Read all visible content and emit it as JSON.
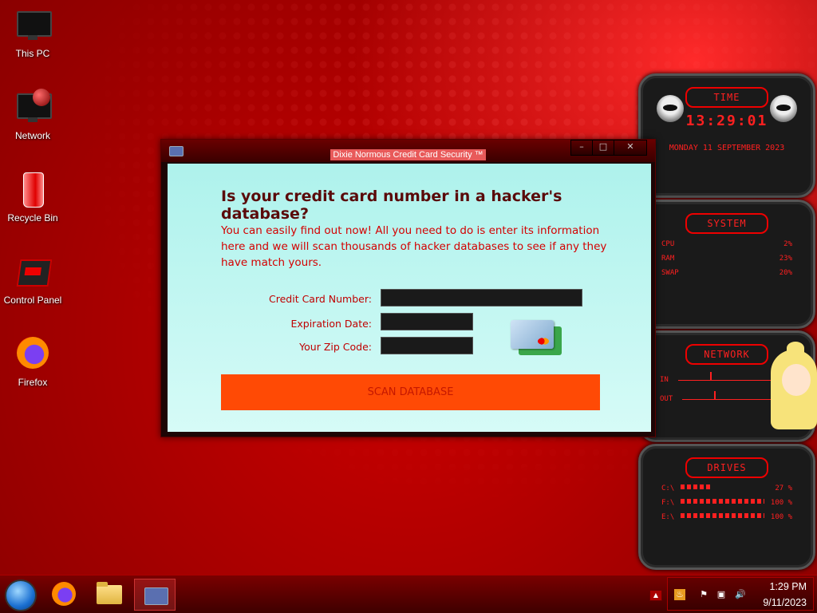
{
  "desktop": {
    "icons": [
      {
        "label": "This PC"
      },
      {
        "label": "Network"
      },
      {
        "label": "Recycle Bin"
      },
      {
        "label": "Control Panel"
      },
      {
        "label": "Firefox"
      }
    ]
  },
  "window": {
    "title": "Dixie Normous Credit Card Security ™",
    "heading": "Is your credit card number in a hacker's database?",
    "description": "You can easily find out now! All you need to do is enter its information here and we will scan thousands of hacker databases to see if any they have match yours.",
    "fields": {
      "card_number_label": "Credit Card Number:",
      "card_number_value": "",
      "expiration_label": "Expiration Date:",
      "expiration_value": "",
      "zip_label": "Your Zip Code:",
      "zip_value": ""
    },
    "scan_button": "SCAN DATABASE"
  },
  "widgets": {
    "time": {
      "title": "TIME",
      "clock": "13:29:01",
      "date": "MONDAY 11 SEPTEMBER 2023"
    },
    "system": {
      "title": "SYSTEM",
      "rows": [
        {
          "name": "CPU",
          "value": "2%"
        },
        {
          "name": "RAM",
          "value": "23%"
        },
        {
          "name": "SWAP",
          "value": "20%"
        }
      ]
    },
    "network": {
      "title": "NETWORK",
      "in_label": "IN",
      "out_label": "OUT"
    },
    "drives": {
      "title": "DRIVES",
      "rows": [
        {
          "name": "C:\\",
          "value": "27 %"
        },
        {
          "name": "F:\\",
          "value": "100 %"
        },
        {
          "name": "E:\\",
          "value": "100 %"
        }
      ]
    }
  },
  "taskbar": {
    "time": "1:29 PM",
    "date": "9/11/2023"
  },
  "colors": {
    "accent": "#ff4a05",
    "dialog_bg": "#aef2ec",
    "text_red": "#d40000",
    "heading": "#5a0a0a",
    "widget_red": "#ff2020"
  }
}
